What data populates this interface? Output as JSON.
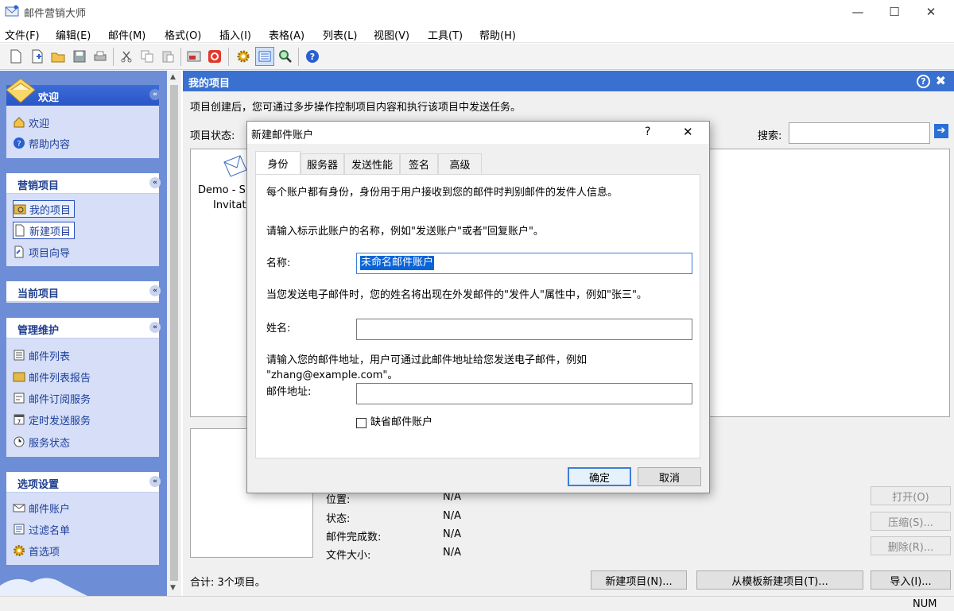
{
  "window": {
    "title": "邮件营销大师",
    "minimize": "—",
    "maximize": "☐",
    "close": "✕"
  },
  "menu": [
    "文件(F)",
    "编辑(E)",
    "邮件(M)",
    "格式(O)",
    "插入(I)",
    "表格(A)",
    "列表(L)",
    "视图(V)",
    "工具(T)",
    "帮助(H)"
  ],
  "sidebar": {
    "welcome": {
      "header": "欢迎",
      "items": [
        "欢迎",
        "帮助内容"
      ]
    },
    "marketing": {
      "header": "营销项目",
      "items": [
        "我的项目",
        "新建项目",
        "项目向导"
      ]
    },
    "current": {
      "header": "当前项目"
    },
    "maintenance": {
      "header": "管理维护",
      "items": [
        "邮件列表",
        "邮件列表报告",
        "邮件订阅服务",
        "定时发送服务",
        "服务状态"
      ]
    },
    "options": {
      "header": "选项设置",
      "items": [
        "邮件账户",
        "过滤名单",
        "首选项"
      ]
    }
  },
  "main": {
    "header": "我的项目",
    "description": "项目创建后，您可通过多步操作控制项目内容和执行该项目中发送任务。",
    "status_label": "项目状态:",
    "search_label": "搜索:",
    "search_value": "",
    "project_name_line1": "Demo - S",
    "project_name_line2": "Invitati",
    "details": [
      {
        "label": "位置:",
        "value": "N/A"
      },
      {
        "label": "状态:",
        "value": "N/A"
      },
      {
        "label": "邮件完成数:",
        "value": "N/A"
      },
      {
        "label": "文件大小:",
        "value": "N/A"
      }
    ],
    "open_button": "打开(O)",
    "compress_button": "压缩(S)...",
    "delete_button": "删除(R)...",
    "total_text": "合计: 3个项目。",
    "new_project_button": "新建项目(N)...",
    "new_from_template_button": "从模板新建项目(T)...",
    "import_button": "导入(I)..."
  },
  "statusbar": {
    "num": "NUM"
  },
  "dialog": {
    "title": "新建邮件账户",
    "help": "?",
    "close": "✕",
    "tabs": [
      "身份",
      "服务器",
      "发送性能",
      "签名",
      "高级"
    ],
    "active_tab": "身份",
    "intro": "每个账户都有身份，身份用于用户接收到您的邮件时判别邮件的发件人信息。",
    "name_hint": "请输入标示此账户的名称，例如\"发送账户\"或者\"回复账户\"。",
    "name_label": "名称:",
    "name_value": "未命名邮件账户",
    "sender_hint": "当您发送电子邮件时，您的姓名将出现在外发邮件的\"发件人\"属性中，例如\"张三\"。",
    "fullname_label": "姓名:",
    "fullname_value": "",
    "email_hint_line1": "请输入您的邮件地址，用户可通过此邮件地址给您发送电子邮件，例如",
    "email_hint_line2": "\"zhang@example.com\"。",
    "email_label": "邮件地址:",
    "email_value": "",
    "default_checkbox_label": "缺省邮件账户",
    "default_checked": false,
    "ok_button": "确定",
    "cancel_button": "取消"
  }
}
